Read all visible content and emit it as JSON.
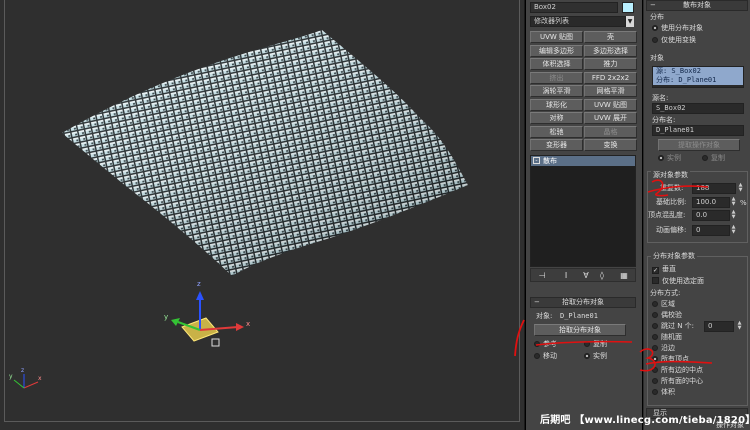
{
  "viewport": {
    "gizmo_x": "x",
    "gizmo_y": "y",
    "gizmo_z": "z",
    "corner_x": "x",
    "corner_y": "y",
    "corner_z": "z"
  },
  "modifier_panel": {
    "object_name": "Box02",
    "color_swatch": "#b9f0ff",
    "modifier_list": "修改器列表",
    "buttons": [
      [
        "UVW 贴图",
        "壳"
      ],
      [
        "编辑多边形",
        "多边形选择"
      ],
      [
        "体积选择",
        "推力"
      ],
      [
        "挤出",
        "FFD 2x2x2"
      ],
      [
        "涡轮平滑",
        "网格平滑"
      ],
      [
        "球形化",
        "UVW 贴图"
      ],
      [
        "对称",
        "UVW 展开"
      ],
      [
        "松驰",
        "晶格"
      ],
      [
        "变形器",
        "变换"
      ]
    ],
    "stack_item": "散布",
    "pick_rollout": {
      "title": "拾取分布对象",
      "object_label": "对象:",
      "object_value": "D_Plane01",
      "pick_button": "拾取分布对象",
      "options": [
        "参考",
        "复制",
        "移动",
        "实例"
      ]
    }
  },
  "scatter_panel": {
    "title": "散布对象",
    "distribution_label": "分布",
    "dist_options": [
      "使用分布对象",
      "仅使用变换"
    ],
    "objects_label": "对象",
    "object_list": [
      "源: S_Box02",
      "分布: D_Plane01"
    ],
    "source_name_label": "源名:",
    "source_name": "S_Box02",
    "dist_name_label": "分布名:",
    "dist_name": "D_Plane01",
    "extract_button": "提取操作对象",
    "extract_options": [
      "实例",
      "复制"
    ],
    "source_params_label": "源对象参数",
    "duplicates_label": "重复数:",
    "duplicates_value": "188",
    "base_scale_label": "基础比例:",
    "base_scale_value": "100.0",
    "base_scale_unit": "%",
    "vertex_chaos_label": "顶点混乱度:",
    "vertex_chaos_value": "0.0",
    "anim_offset_label": "动画偏移:",
    "anim_offset_value": "0",
    "dist_params_label": "分布对象参数",
    "perpendicular_label": "垂直",
    "selected_faces_label": "仅使用选定面",
    "dist_method_label": "分布方式:",
    "methods": [
      "区域",
      "偶校验",
      "跳过 N 个:",
      "随机面",
      "沿边",
      "所有顶点",
      "所有边的中点",
      "所有面的中心",
      "体积"
    ],
    "skip_n_value": "0",
    "display_label": "显示"
  },
  "bottom_cut": {
    "left": "变换",
    "right": "操作对象"
  },
  "watermark": "后期吧 【www.linecg.com/tieba/1820】",
  "annotations": [
    "1",
    "2",
    "3"
  ]
}
